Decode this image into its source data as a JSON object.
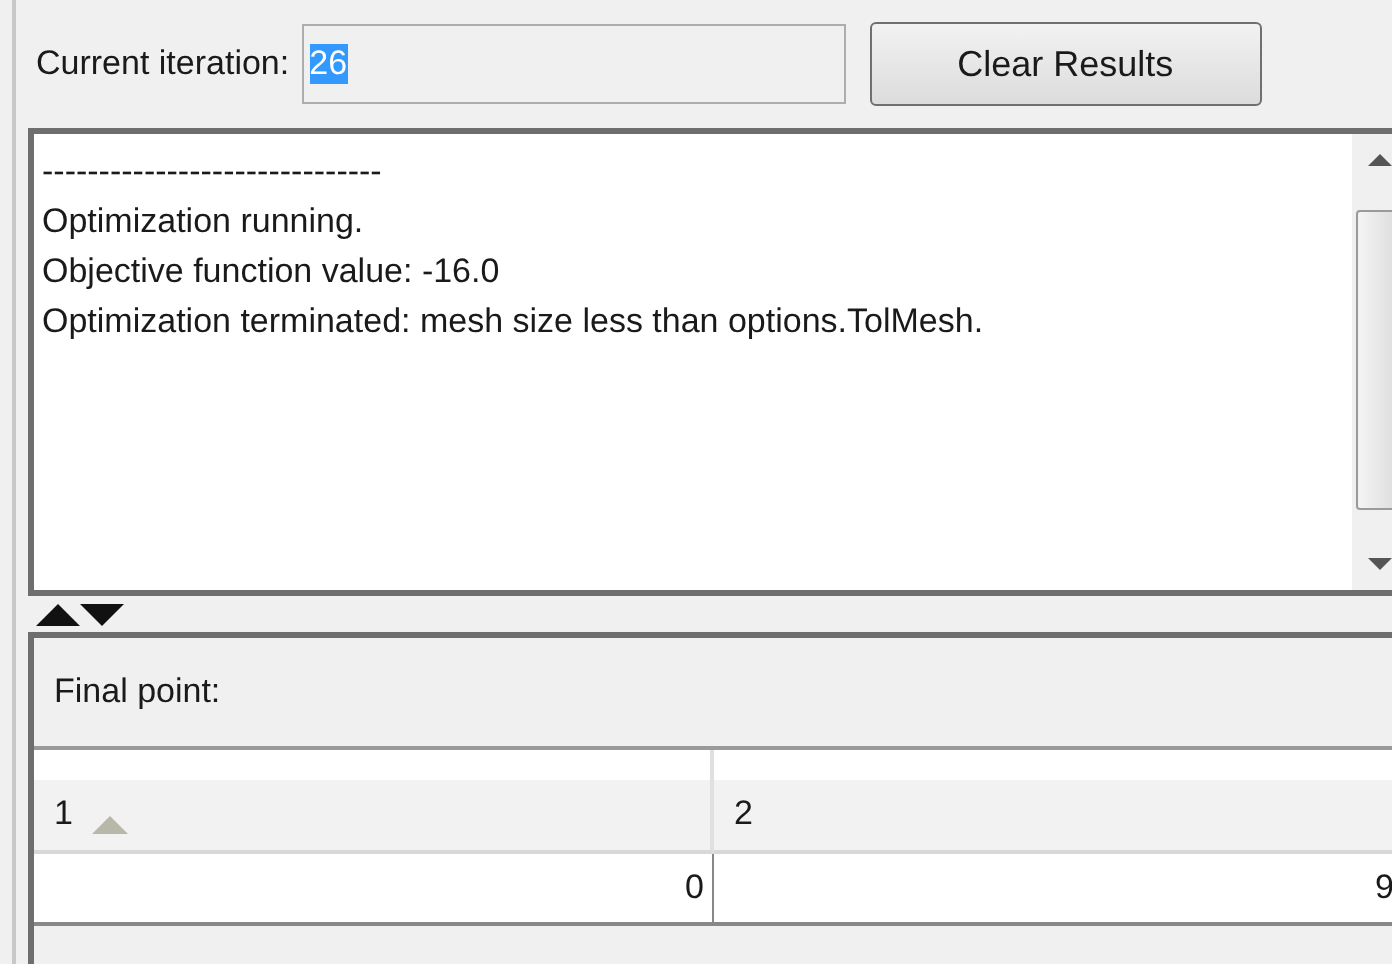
{
  "iteration": {
    "label": "Current iteration:",
    "value": "26",
    "selected": true
  },
  "clear_button": "Clear Results",
  "output_lines": [
    "------------------------------",
    "Optimization running.",
    "Objective function value: -16.0",
    "Optimization terminated: mesh size less than options.TolMesh."
  ],
  "final_point": {
    "label": "Final point:",
    "columns": [
      {
        "label": "1",
        "sorted": true
      },
      {
        "label": "2",
        "sorted": false
      }
    ],
    "rows": [
      [
        "0",
        "9"
      ]
    ]
  }
}
